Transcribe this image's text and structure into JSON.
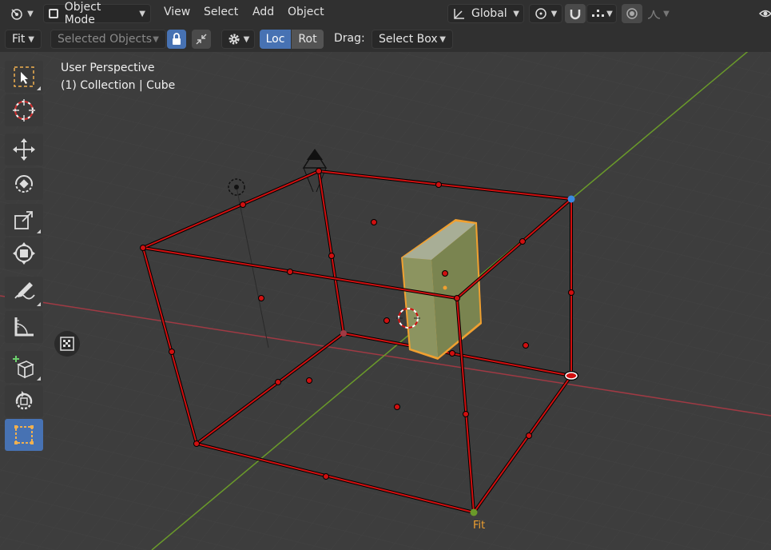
{
  "header": {
    "mode": "Object Mode",
    "menus": [
      "View",
      "Select",
      "Add",
      "Object"
    ],
    "transform_orientation": "Global"
  },
  "tool_settings": {
    "pivot_fit": "Fit",
    "affect": "Selected Objects",
    "loc": "Loc",
    "rot": "Rot",
    "drag_label": "Drag:",
    "drag_value": "Select Box"
  },
  "viewport": {
    "view_name": "User Perspective",
    "collection_info": "(1) Collection | Cube",
    "gizmo_label": "Fit"
  },
  "colors": {
    "accent": "#4772b3",
    "cage": "#d01010",
    "selection_outline": "#f0a030",
    "grid_x_axis": "#a03a44",
    "grid_y_axis": "#6a9a2a"
  }
}
